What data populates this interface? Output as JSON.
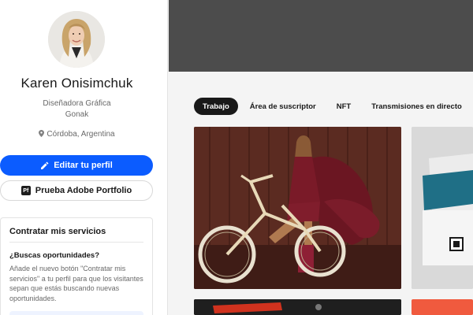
{
  "profile": {
    "name": "Karen Onisimchuk",
    "occupation_line1": "Diseñadora Gráfica",
    "occupation_line2": "Gonak",
    "location": "Córdoba, Argentina",
    "location_icon": "pin-icon",
    "avatar_alt": "avatar"
  },
  "actions": {
    "edit_profile": "Editar tu perfil",
    "edit_icon": "pencil-icon",
    "adobe_portfolio": "Prueba Adobe Portfolio",
    "adobe_badge": "Pf"
  },
  "hire": {
    "title": "Contratar mis servicios",
    "question": "¿Buscas oportunidades?",
    "description": "Añade el nuevo botón \"Contratar mis servicios\" a tu perfil para que los visitantes sepan que estás buscando nuevas oportunidades."
  },
  "tabs": [
    {
      "label": "Trabajo",
      "active": true
    },
    {
      "label": "Área de suscriptor",
      "active": false
    },
    {
      "label": "NFT",
      "active": false
    },
    {
      "label": "Transmisiones en directo",
      "active": false
    }
  ],
  "colors": {
    "accent": "#0b5cff",
    "banner": "#4c4c4c",
    "tab_active_bg": "#191919"
  }
}
